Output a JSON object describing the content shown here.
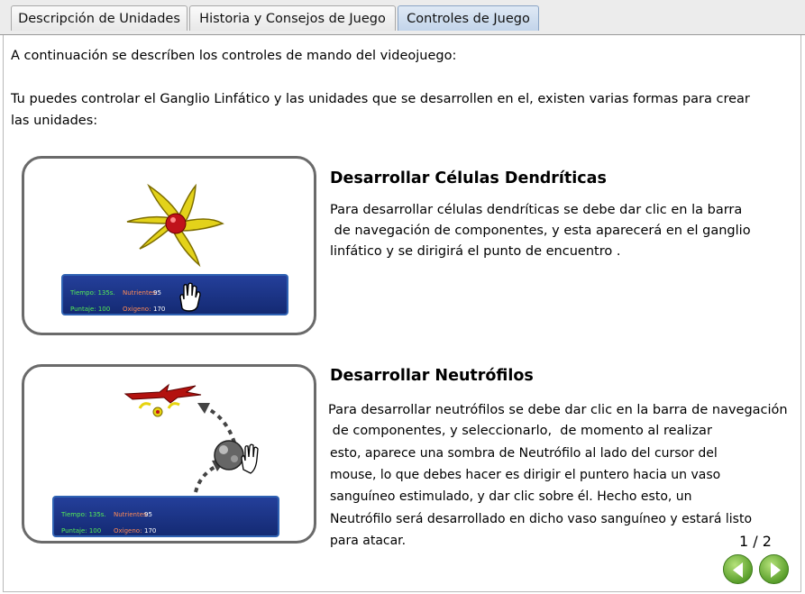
{
  "tabs": [
    {
      "label": "Descripción de Unidades",
      "active": false
    },
    {
      "label": "Historia y Consejos de Juego",
      "active": false
    },
    {
      "label": "Controles de Juego",
      "active": true
    }
  ],
  "intro": {
    "line1": "A continuación se descríben los controles de mando del videojuego:",
    "line2": "Tu puedes controlar el Ganglio Linfático y las unidades que se desarrollen en el, existen varias formas para crear",
    "line3": "las unidades:"
  },
  "sections": [
    {
      "title": "Desarrollar Células Dendríticas",
      "lines": [
        "Para desarrollar células dendríticas se debe dar clic en la barra",
        " de navegación de componentes, y esta aparecerá en el ganglio",
        "linfático y se dirigirá el punto de encuentro ."
      ],
      "hud": {
        "tiempo": "Tiempo: 135s.",
        "puntaje": "Puntaje: 100",
        "nutrientes": "Nutrientes:",
        "nutrientes_val": "95",
        "oxigeno": "Oxigeno:",
        "oxigeno_val": "170"
      }
    },
    {
      "title": "Desarrollar Neutrófilos",
      "lines": [
        "Para desarrollar neutrófilos se debe dar clic en la barra de navegación",
        " de componentes, y seleccionarlo,  de momento al realizar",
        "esto, aparece una sombra de Neutrófilo al lado del cursor del",
        "mouse, lo que debes hacer es dirigir el puntero hacia un vaso",
        "sanguíneo estimulado, y dar clic sobre él. Hecho esto, un",
        "Neutrófilo será desarrollado en dicho vaso sanguíneo y estará listo",
        "para atacar."
      ],
      "hud": {
        "tiempo": "Tiempo: 135s.",
        "puntaje": "Puntaje: 100",
        "nutrientes": "Nutrientes:",
        "nutrientes_val": "95",
        "oxigeno": "Oxigeno:",
        "oxigeno_val": "170"
      }
    }
  ],
  "pager": {
    "text": "1 / 2"
  },
  "nav": {
    "prev_icon": "arrow-left-icon",
    "next_icon": "arrow-right-icon",
    "color": "#5a9f2b"
  }
}
